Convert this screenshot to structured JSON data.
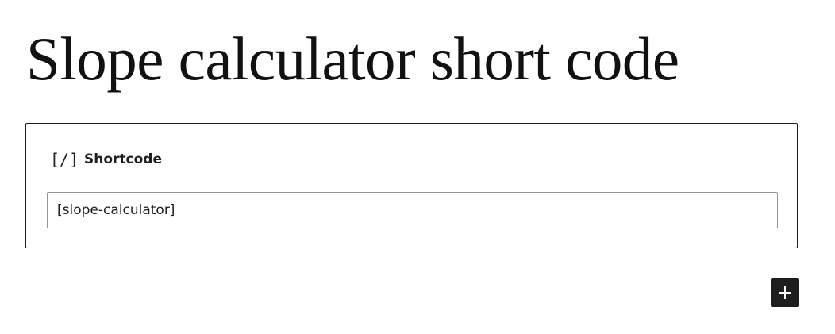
{
  "page": {
    "title": "Slope calculator short code"
  },
  "shortcode_block": {
    "icon": "shortcode-icon",
    "icon_glyph": "[/]",
    "label": "Shortcode",
    "value": "[slope-calculator]"
  },
  "add_block_button": {
    "icon": "plus-icon",
    "color": "#1e1e1e"
  }
}
